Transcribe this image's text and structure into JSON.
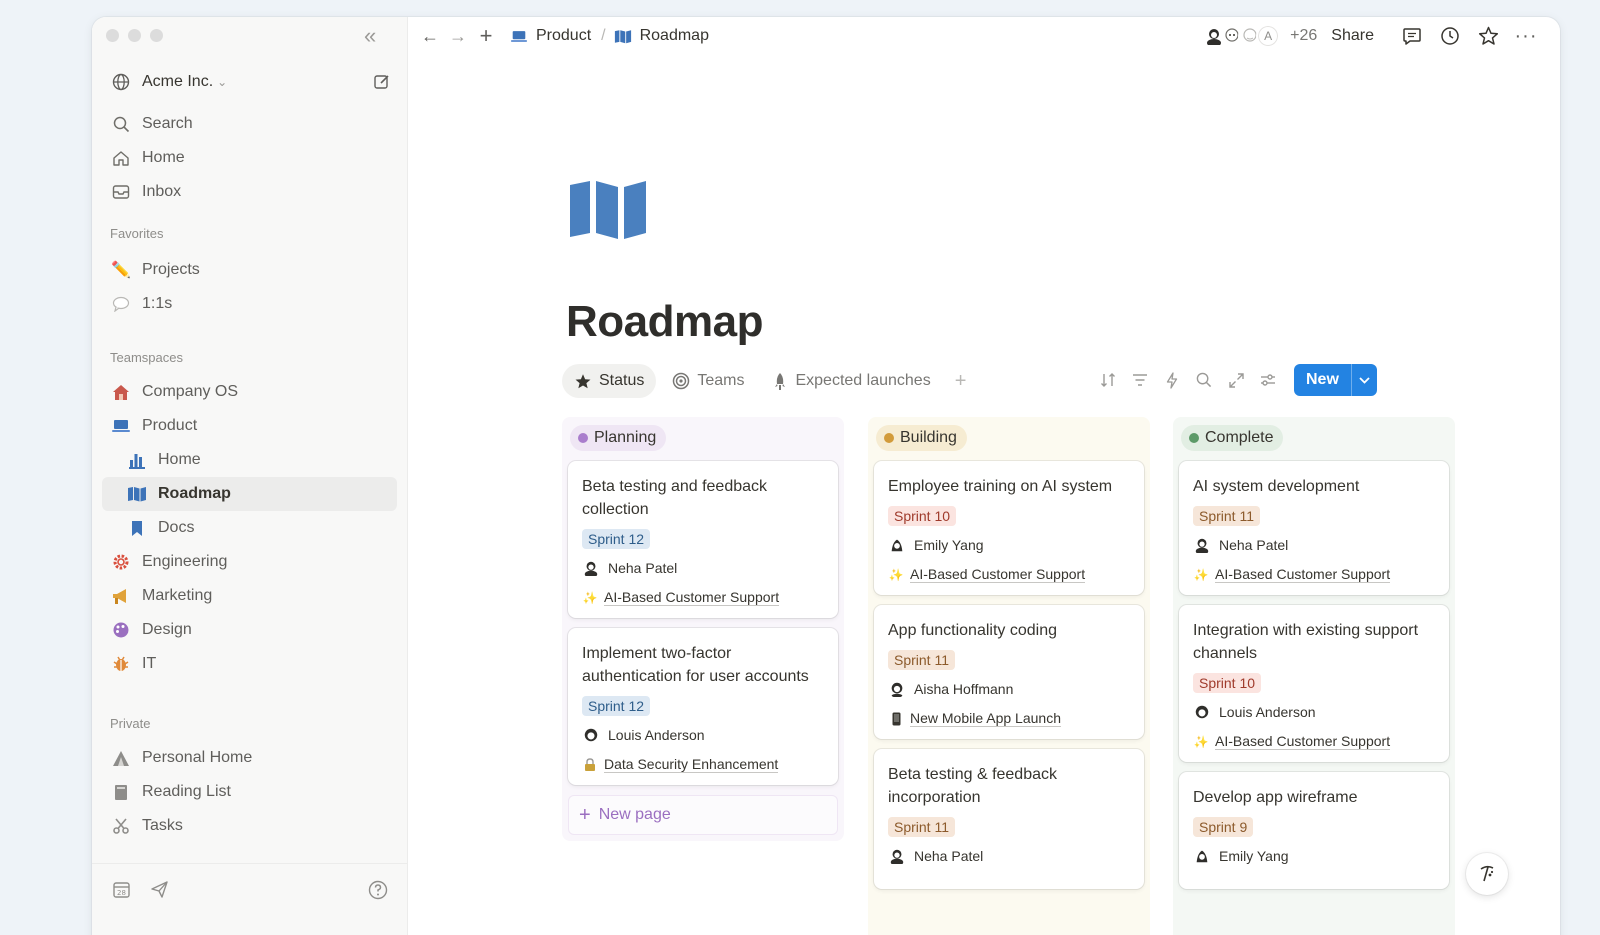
{
  "sidebar": {
    "workspace": {
      "name": "Acme Inc."
    },
    "main_nav": [
      {
        "label": "Search",
        "icon": "search-icon"
      },
      {
        "label": "Home",
        "icon": "home-icon"
      },
      {
        "label": "Inbox",
        "icon": "inbox-icon"
      }
    ],
    "favorites_label": "Favorites",
    "favorites": [
      {
        "label": "Projects",
        "icon": "pencil-icon"
      },
      {
        "label": "1:1s",
        "icon": "speech-bubble-icon"
      }
    ],
    "teamspaces_label": "Teamspaces",
    "teamspaces": [
      {
        "label": "Company OS",
        "icon": "house-icon"
      },
      {
        "label": "Product",
        "icon": "laptop-icon"
      },
      {
        "label": "Home",
        "icon": "chart-icon"
      },
      {
        "label": "Roadmap",
        "icon": "map-icon"
      },
      {
        "label": "Docs",
        "icon": "bookmark-icon"
      },
      {
        "label": "Engineering",
        "icon": "gear-icon"
      },
      {
        "label": "Marketing",
        "icon": "megaphone-icon"
      },
      {
        "label": "Design",
        "icon": "palette-icon"
      },
      {
        "label": "IT",
        "icon": "bug-icon"
      }
    ],
    "private_label": "Private",
    "private": [
      {
        "label": "Personal Home",
        "icon": "tent-icon"
      },
      {
        "label": "Reading List",
        "icon": "book-icon"
      },
      {
        "label": "Tasks",
        "icon": "scissors-icon"
      }
    ]
  },
  "topbar": {
    "breadcrumb": [
      {
        "label": "Product"
      },
      {
        "label": "Roadmap"
      }
    ],
    "avatar_letter": "A",
    "more_count": "+26",
    "share_label": "Share"
  },
  "page": {
    "title": "Roadmap",
    "views": [
      {
        "label": "Status"
      },
      {
        "label": "Teams"
      },
      {
        "label": "Expected launches"
      }
    ],
    "new_label": "New"
  },
  "colors": {
    "accent": "#2383e2",
    "planning_bg": "#f9f6fb",
    "building_bg": "#fcfaf0",
    "complete_bg": "#f4f8f4"
  },
  "board": {
    "columns": [
      {
        "status": "Planning",
        "cards": [
          {
            "title": "Beta testing and feedback collection",
            "sprint": "Sprint 12",
            "assignee": "Neha Patel",
            "project": "AI-Based Customer Support",
            "project_icon": "sparkle-icon"
          },
          {
            "title": "Implement two-factor authentication for user accounts",
            "sprint": "Sprint 12",
            "assignee": "Louis Anderson",
            "project": "Data Security Enhancement",
            "project_icon": "lock-icon"
          }
        ],
        "new_page_label": "New page"
      },
      {
        "status": "Building",
        "cards": [
          {
            "title": "Employee training on AI system",
            "sprint": "Sprint 10",
            "assignee": "Emily Yang",
            "project": "AI-Based Customer Support",
            "project_icon": "sparkle-icon"
          },
          {
            "title": "App functionality coding",
            "sprint": "Sprint 11",
            "assignee": "Aisha Hoffmann",
            "project": "New Mobile App Launch",
            "project_icon": "phone-icon"
          },
          {
            "title": "Beta testing & feedback incorporation",
            "sprint": "Sprint 11",
            "assignee": "Neha Patel"
          }
        ]
      },
      {
        "status": "Complete",
        "cards": [
          {
            "title": "AI system development",
            "sprint": "Sprint 11",
            "assignee": "Neha Patel",
            "project": "AI-Based Customer Support",
            "project_icon": "sparkle-icon"
          },
          {
            "title": "Integration with existing support channels",
            "sprint": "Sprint 10",
            "assignee": "Louis Anderson",
            "project": "AI-Based Customer Support",
            "project_icon": "sparkle-icon"
          },
          {
            "title": "Develop app wireframe",
            "sprint": "Sprint 9",
            "assignee": "Emily Yang"
          }
        ]
      }
    ]
  }
}
